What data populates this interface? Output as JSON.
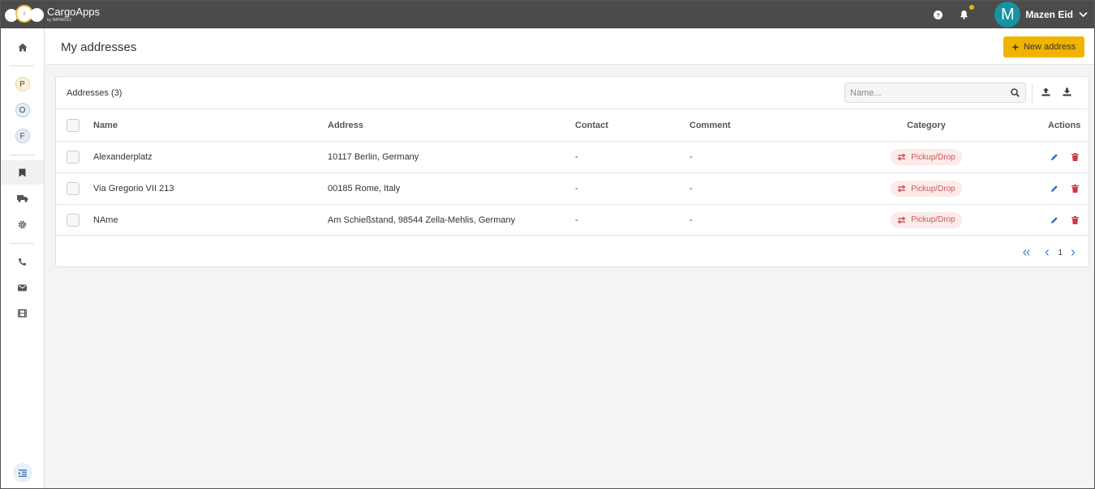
{
  "app": {
    "name": "CargoApps",
    "byline": "by IMPARGO"
  },
  "topbar": {
    "user_initial": "M",
    "user_name": "Mazen Eid",
    "icons": [
      "help-icon",
      "bell-icon",
      "chevron-down-icon"
    ],
    "notification_dot_color": "#f0b400",
    "avatar_color": "#1592a3"
  },
  "sidebar": {
    "items": [
      {
        "name": "home",
        "icon": "home-icon"
      },
      {
        "name": "P",
        "label": "P"
      },
      {
        "name": "O",
        "label": "O"
      },
      {
        "name": "F",
        "label": "F"
      },
      {
        "name": "addresses",
        "icon": "bookmark-icon",
        "active": true
      },
      {
        "name": "trucks",
        "icon": "truck-icon"
      },
      {
        "name": "settings",
        "icon": "gear-icon"
      },
      {
        "name": "phone",
        "icon": "phone-icon"
      },
      {
        "name": "mail",
        "icon": "mail-icon"
      },
      {
        "name": "film",
        "icon": "film-icon"
      },
      {
        "name": "collapse",
        "icon": "indent-icon"
      }
    ]
  },
  "header": {
    "title": "My addresses",
    "new_button": "New address",
    "accent": "#f0b400"
  },
  "card": {
    "title": "Addresses (3)",
    "search_placeholder": "Name...",
    "columns": [
      "Name",
      "Address",
      "Contact",
      "Comment",
      "Category",
      "Actions"
    ],
    "rows": [
      {
        "name": "Alexanderplatz",
        "address": "10117 Berlin, Germany",
        "contact": "-",
        "comment": "-",
        "category": "Pickup/Drop"
      },
      {
        "name": "Via Gregorio VII 213",
        "address": "00185 Rome, Italy",
        "contact": "-",
        "comment": "-",
        "category": "Pickup/Drop"
      },
      {
        "name": "NAme",
        "address": "Am Schießstand, 98544 Zella-Mehlis, Germany",
        "contact": "-",
        "comment": "-",
        "category": "Pickup/Drop"
      }
    ],
    "pagination": {
      "current_page": "1"
    }
  }
}
